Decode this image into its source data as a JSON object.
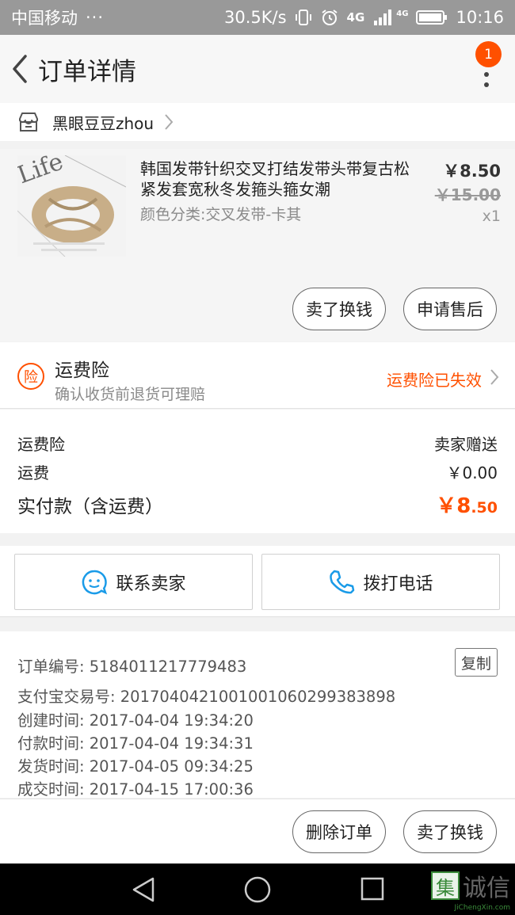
{
  "status_bar": {
    "carrier": "中国移动",
    "dots": "···",
    "speed": "30.5K/s",
    "network": "4G",
    "network2": "4G",
    "time": "10:16"
  },
  "nav": {
    "title": "订单详情",
    "badge": "1"
  },
  "shop": {
    "name": "黑眼豆豆zhou"
  },
  "product": {
    "title": "韩国发带针织交叉打结发带头带复古松紧发套宽秋冬发箍头箍女潮",
    "spec": "颜色分类:交叉发带-卡其",
    "price": "￥8.50",
    "original_price": "￥15.00",
    "quantity": "x1",
    "thumb_text": "Life",
    "btn_sell": "卖了换钱",
    "btn_aftersale": "申请售后"
  },
  "insurance": {
    "icon_text": "险",
    "title": "运费险",
    "subtitle": "确认收货前退货可理赔",
    "status": "运费险已失效"
  },
  "summary": {
    "rows": [
      {
        "label": "运费险",
        "value": "卖家赠送"
      },
      {
        "label": "运费",
        "value": "￥0.00"
      }
    ],
    "total_label": "实付款（含运费）",
    "total_int": "￥8",
    "total_dec": ".50",
    "accent_color": "#ff5000"
  },
  "contact": {
    "seller": "联系卖家",
    "call": "拨打电话"
  },
  "order_info": {
    "copy": "复制",
    "lines": [
      "订单编号: 5184011217779483",
      "支付宝交易号: 2017040421001001060299383898",
      "创建时间: 2017-04-04 19:34:20",
      "付款时间: 2017-04-04 19:34:31",
      "发货时间: 2017-04-05 09:34:25",
      "成交时间: 2017-04-15 17:00:36"
    ]
  },
  "actions": {
    "delete": "删除订单",
    "sell": "卖了换钱"
  },
  "watermark": {
    "logo": "集",
    "text": "诚信",
    "sub": "JiChengXin.com"
  }
}
